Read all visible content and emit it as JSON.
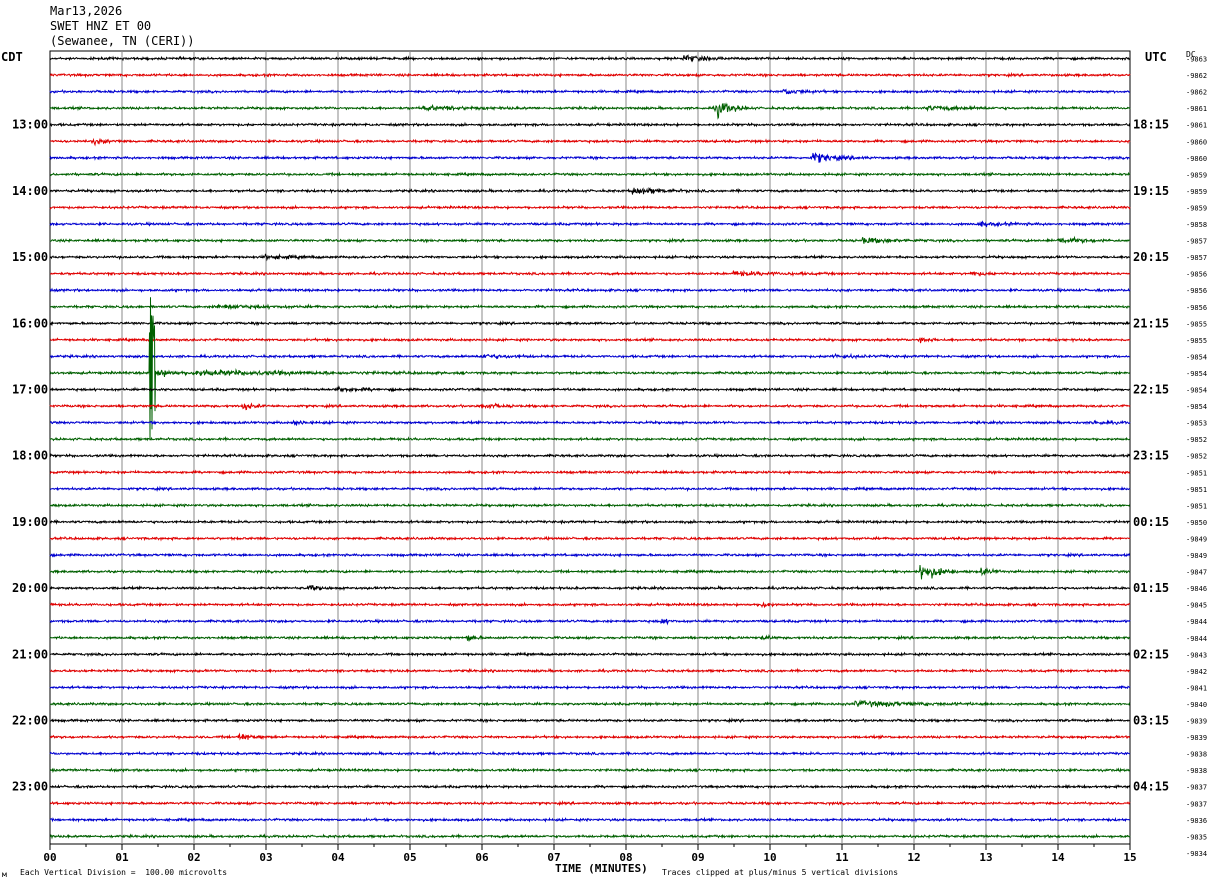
{
  "header": {
    "date": "Mar13,2026",
    "station": "SWET HNZ ET 00",
    "location": "(Sewanee, TN (CERI))"
  },
  "left_axis_title": "CDT",
  "right_axis_title": "UTC",
  "dc_title": "DC",
  "footer": {
    "scale_note": "Each Vertical Division =  100.00 microvolts",
    "clip_note": "Traces clipped at plus/minus 5 vertical divisions",
    "corner_mark": "м"
  },
  "colors": {
    "trace_cycle": [
      "#000000",
      "#e00000",
      "#0000d0",
      "#006000"
    ],
    "grid": "#888888",
    "frame": "#000000"
  },
  "chart_data": {
    "type": "line",
    "xlabel": "TIME (MINUTES)",
    "xlim": [
      0,
      15
    ],
    "x_ticks": [
      "00",
      "01",
      "02",
      "03",
      "04",
      "05",
      "06",
      "07",
      "08",
      "09",
      "10",
      "11",
      "12",
      "13",
      "14",
      "15"
    ],
    "grid": true,
    "row_count": 48,
    "left_hour_labels": [
      "13:00",
      "14:00",
      "15:00",
      "16:00",
      "17:00",
      "18:00",
      "19:00",
      "20:00",
      "21:00",
      "22:00",
      "23:00"
    ],
    "right_hour_labels": [
      "18:15",
      "19:15",
      "20:15",
      "21:15",
      "22:15",
      "23:15",
      "00:15",
      "01:15",
      "02:15",
      "03:15",
      "04:15"
    ],
    "dc_offsets": [
      "-9863",
      "-9862",
      "-9862",
      "-9861",
      "-9861",
      "-9860",
      "-9860",
      "-9859",
      "-9859",
      "-9859",
      "-9858",
      "-9857",
      "-9857",
      "-9856",
      "-9856",
      "-9856",
      "-9855",
      "-9855",
      "-9854",
      "-9854",
      "-9854",
      "-9854",
      "-9853",
      "-9852",
      "-9852",
      "-9851",
      "-9851",
      "-9851",
      "-9850",
      "-9849",
      "-9849",
      "-9847",
      "-9846",
      "-9845",
      "-9844",
      "-9844",
      "-9843",
      "-9842",
      "-9841",
      "-9840",
      "-9839",
      "-9839",
      "-9838",
      "-9838",
      "-9837",
      "-9837",
      "-9836",
      "-9835",
      "-9834"
    ],
    "events": [
      {
        "row": 0,
        "minute": 8.8,
        "amp": 2.5,
        "dur": 0.6
      },
      {
        "row": 2,
        "minute": 10.2,
        "amp": 2,
        "dur": 0.6
      },
      {
        "row": 3,
        "minute": 5.2,
        "amp": 1.5,
        "dur": 1.5
      },
      {
        "row": 3,
        "minute": 9.25,
        "amp": 7,
        "dur": 0.5
      },
      {
        "row": 3,
        "minute": 12.2,
        "amp": 1.5,
        "dur": 1.2
      },
      {
        "row": 5,
        "minute": 0.6,
        "amp": 2,
        "dur": 0.5
      },
      {
        "row": 6,
        "minute": 10.6,
        "amp": 4,
        "dur": 0.8
      },
      {
        "row": 8,
        "minute": 8.1,
        "amp": 3,
        "dur": 0.8
      },
      {
        "row": 10,
        "minute": 12.9,
        "amp": 1.5,
        "dur": 1.0
      },
      {
        "row": 11,
        "minute": 11.3,
        "amp": 2,
        "dur": 1.0
      },
      {
        "row": 11,
        "minute": 14.0,
        "amp": 2.5,
        "dur": 0.8
      },
      {
        "row": 12,
        "minute": 3.0,
        "amp": 1.5,
        "dur": 0.8
      },
      {
        "row": 13,
        "minute": 9.5,
        "amp": 1.5,
        "dur": 1.5
      },
      {
        "row": 13,
        "minute": 12.8,
        "amp": 1.5,
        "dur": 0.6
      },
      {
        "row": 15,
        "minute": 2.3,
        "amp": 1.5,
        "dur": 1.5
      },
      {
        "row": 17,
        "minute": 12.1,
        "amp": 3,
        "dur": 0.2
      },
      {
        "row": 18,
        "minute": 6.0,
        "amp": 1.5,
        "dur": 1.0
      },
      {
        "row": 18,
        "minute": 10.8,
        "amp": 1.2,
        "dur": 1.0
      },
      {
        "row": 19,
        "minute": 1.4,
        "amp": 80,
        "dur": 0.6
      },
      {
        "row": 19,
        "minute": 2.0,
        "amp": 2,
        "dur": 3.5
      },
      {
        "row": 20,
        "minute": 4.0,
        "amp": 1.5,
        "dur": 0.8
      },
      {
        "row": 21,
        "minute": 2.7,
        "amp": 3,
        "dur": 0.3
      },
      {
        "row": 21,
        "minute": 6.0,
        "amp": 2,
        "dur": 0.5
      },
      {
        "row": 22,
        "minute": 3.4,
        "amp": 1.5,
        "dur": 0.5
      },
      {
        "row": 22,
        "minute": 14.5,
        "amp": 1.5,
        "dur": 0.5
      },
      {
        "row": 32,
        "minute": 3.6,
        "amp": 2,
        "dur": 0.3
      },
      {
        "row": 31,
        "minute": 12.1,
        "amp": 8,
        "dur": 0.5
      },
      {
        "row": 31,
        "minute": 12.95,
        "amp": 2.5,
        "dur": 0.3
      },
      {
        "row": 33,
        "minute": 9.9,
        "amp": 3,
        "dur": 0.2
      },
      {
        "row": 34,
        "minute": 8.5,
        "amp": 2,
        "dur": 0.2
      },
      {
        "row": 35,
        "minute": 5.8,
        "amp": 3,
        "dur": 0.2
      },
      {
        "row": 35,
        "minute": 9.9,
        "amp": 2,
        "dur": 0.2
      },
      {
        "row": 39,
        "minute": 11.2,
        "amp": 2,
        "dur": 2.0
      },
      {
        "row": 41,
        "minute": 2.6,
        "amp": 2.5,
        "dur": 0.5
      }
    ]
  }
}
